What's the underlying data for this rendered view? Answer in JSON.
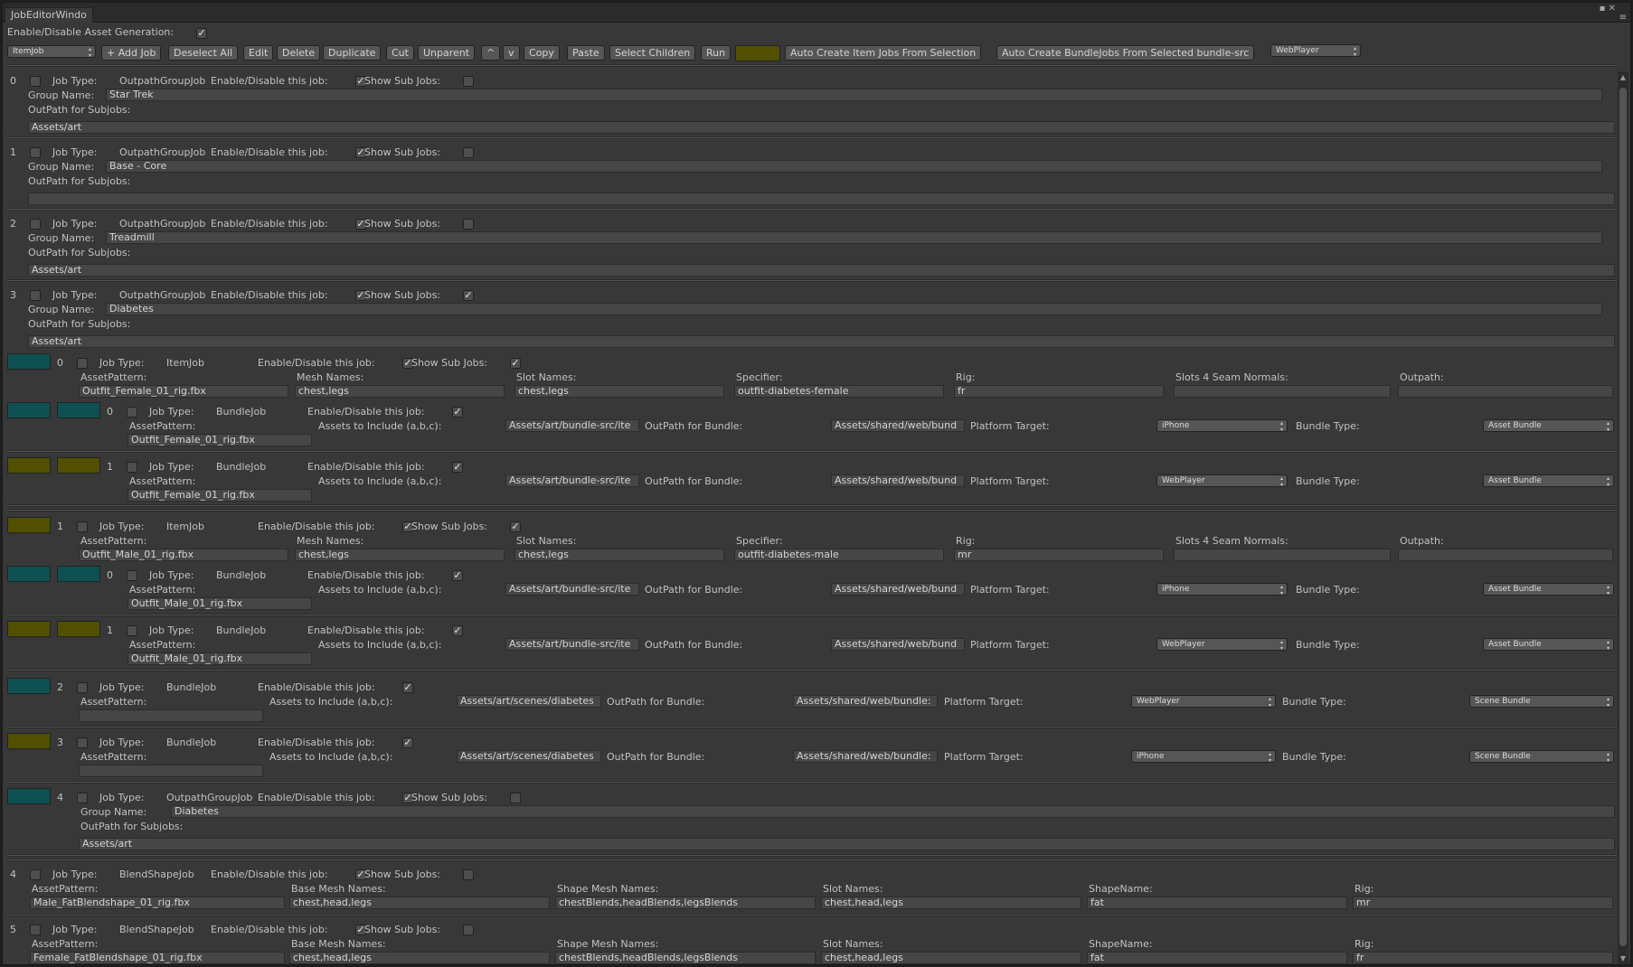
{
  "window": {
    "title": "JobEditorWindo",
    "controls": "▪ ✕",
    "menu": "≡"
  },
  "toolbar": {
    "enable_label": "Enable/Disable Asset Generation:",
    "job_type": "ItemJob",
    "add_job": "+ Add Job",
    "deselect_all": "Deselect All",
    "edit": "Edit",
    "delete": "Delete",
    "duplicate": "Duplicate",
    "cut": "Cut",
    "unparent": "Unparent",
    "up": "^",
    "down": "v",
    "copy": "Copy",
    "paste": "Paste",
    "select_children": "Select Children",
    "run": "Run",
    "auto_item": "Auto Create Item Jobs From Selection",
    "auto_bundle": "Auto Create BundleJobs From Selected bundle-src",
    "platform": "WebPlayer"
  },
  "labels": {
    "job_type": "Job Type:",
    "enable_job": "Enable/Disable this job:",
    "show_sub": "Show Sub Jobs:",
    "group_name": "Group Name:",
    "outpath_sub": "OutPath for Subjobs:",
    "asset_pattern": "AssetPattern:",
    "mesh_names": "Mesh Names:",
    "slot_names": "Slot Names:",
    "specifier": "Specifier:",
    "rig": "Rig:",
    "seam": "Slots 4 Seam Normals:",
    "outpath": "Outpath:",
    "assets_include": "Assets to Include (a,b,c):",
    "outpath_bundle": "OutPath for Bundle:",
    "platform_target": "Platform Target:",
    "bundle_type": "Bundle Type:",
    "base_mesh": "Base Mesh Names:",
    "shape_mesh": "Shape Mesh Names:",
    "shape_name": "ShapeName:"
  },
  "check": "✓",
  "groups": [
    {
      "index": "0",
      "type": "OutpathGroupJob",
      "name": "Star Trek",
      "outpath": "Assets/art"
    },
    {
      "index": "1",
      "type": "OutpathGroupJob",
      "name": "Base - Core",
      "outpath": ""
    },
    {
      "index": "2",
      "type": "OutpathGroupJob",
      "name": "Treadmill",
      "outpath": "Assets/art"
    },
    {
      "index": "3",
      "type": "OutpathGroupJob",
      "name": "Diabetes",
      "outpath": "Assets/art"
    }
  ],
  "items": [
    {
      "index": "0",
      "type": "ItemJob",
      "asset": "Outfit_Female_01_rig.fbx",
      "mesh": "chest,legs",
      "slots": "chest,legs",
      "spec": "outfit-diabetes-female",
      "rig": "fr",
      "seam": "",
      "outpath": ""
    },
    {
      "index": "1",
      "type": "ItemJob",
      "asset": "Outfit_Male_01_rig.fbx",
      "mesh": "chest,legs",
      "slots": "chest,legs",
      "spec": "outfit-diabetes-male",
      "rig": "mr",
      "seam": "",
      "outpath": ""
    }
  ],
  "bundles": [
    {
      "index": "0",
      "type": "BundleJob",
      "asset": "Outfit_Female_01_rig.fbx",
      "include": "Assets/art/bundle-src/ite",
      "outbundle": "Assets/shared/web/bund",
      "platform": "iPhone",
      "btype": "Asset Bundle"
    },
    {
      "index": "1",
      "type": "BundleJob",
      "asset": "Outfit_Female_01_rig.fbx",
      "include": "Assets/art/bundle-src/ite",
      "outbundle": "Assets/shared/web/bund",
      "platform": "WebPlayer",
      "btype": "Asset Bundle"
    },
    {
      "index": "0",
      "type": "BundleJob",
      "asset": "Outfit_Male_01_rig.fbx",
      "include": "Assets/art/bundle-src/ite",
      "outbundle": "Assets/shared/web/bund",
      "platform": "iPhone",
      "btype": "Asset Bundle"
    },
    {
      "index": "1",
      "type": "BundleJob",
      "asset": "Outfit_Male_01_rig.fbx",
      "include": "Assets/art/bundle-src/ite",
      "outbundle": "Assets/shared/web/bund",
      "platform": "WebPlayer",
      "btype": "Asset Bundle"
    }
  ],
  "scene_bundles": [
    {
      "index": "2",
      "type": "BundleJob",
      "asset": "",
      "include": "Assets/art/scenes/diabetes",
      "outbundle": "Assets/shared/web/bundle:",
      "platform": "WebPlayer",
      "btype": "Scene Bundle"
    },
    {
      "index": "3",
      "type": "BundleJob",
      "asset": "",
      "include": "Assets/art/scenes/diabetes",
      "outbundle": "Assets/shared/web/bundle:",
      "platform": "iPhone",
      "btype": "Scene Bundle"
    }
  ],
  "subgroup": {
    "index": "4",
    "type": "OutpathGroupJob",
    "name": "Diabetes",
    "outpath": "Assets/art"
  },
  "blends": [
    {
      "index": "4",
      "type": "BlendShapeJob",
      "asset": "Male_FatBlendshape_01_rig.fbx",
      "base": "chest,head,legs",
      "shape": "chestBlends,headBlends,legsBlends",
      "slots": "chest,head,legs",
      "sname": "fat",
      "rig": "mr"
    },
    {
      "index": "5",
      "type": "BlendShapeJob",
      "asset": "Female_FatBlendshape_01_rig.fbx",
      "base": "chest,head,legs",
      "shape": "chestBlends,headBlends,legsBlends",
      "slots": "chest,head,legs",
      "sname": "fat",
      "rig": "fr"
    }
  ]
}
